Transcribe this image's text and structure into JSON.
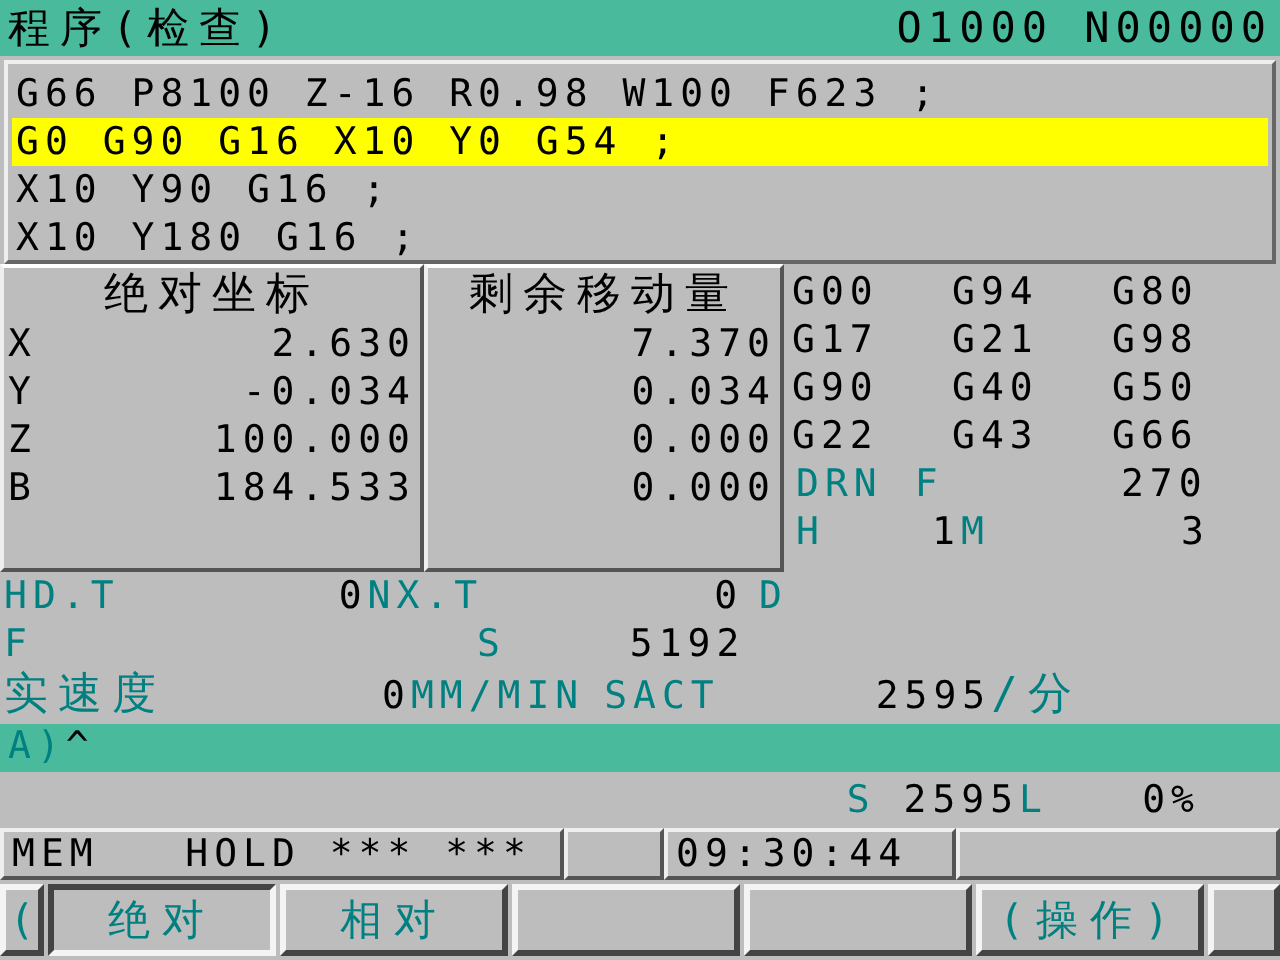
{
  "header": {
    "title": "程序(检查)",
    "program_number": "O1000 N00000"
  },
  "program_lines": [
    {
      "text": "G66 P8100 Z-16 R0.98 W100 F623 ;",
      "selected": false
    },
    {
      "text": "G0 G90 G16 X10 Y0 G54 ;",
      "selected": true
    },
    {
      "text": "X10 Y90 G16 ;",
      "selected": false
    },
    {
      "text": "X10 Y180 G16 ;",
      "selected": false
    }
  ],
  "absolute": {
    "title": "绝对坐标",
    "axes": [
      {
        "axis": "X",
        "value": "2.630"
      },
      {
        "axis": "Y",
        "value": "-0.034"
      },
      {
        "axis": "Z",
        "value": "100.000"
      },
      {
        "axis": "B",
        "value": "184.533"
      }
    ]
  },
  "distance_to_go": {
    "title": "剩余移动量",
    "values": [
      "7.370",
      "0.034",
      "0.000",
      "0.000"
    ]
  },
  "modal_codes": [
    [
      "G00",
      "G94",
      "G80"
    ],
    [
      "G17",
      "G21",
      "G98"
    ],
    [
      "G90",
      "G40",
      "G50"
    ],
    [
      "G22",
      "G43",
      "G66"
    ]
  ],
  "drn": {
    "label": "DRN",
    "feed_label": "F",
    "feed_value": "270"
  },
  "hm": {
    "h_label": "H",
    "h_value": "1",
    "m_label": "M",
    "m_value": "3"
  },
  "tool_row": {
    "hd_label": "HD.T",
    "hd_value": "0",
    "nx_label": "NX.T",
    "nx_value": "0",
    "d_label": "D"
  },
  "fs_row": {
    "f_label": "F",
    "s_label": "S",
    "s_value": "5192"
  },
  "speed_row": {
    "label": "实速度",
    "feed_value": "0",
    "feed_unit": "MM/MIN",
    "sact_label": "SACT",
    "sact_value": "2595",
    "sact_unit": "/分"
  },
  "input_line": {
    "prompt": "A)",
    "cursor": "^"
  },
  "spindle_row": {
    "s_label": "S",
    "s_value": "2595",
    "l_label": "L",
    "l_value": "0%"
  },
  "status_bar": {
    "mode": "MEM",
    "state": "HOLD",
    "alarm_1": "***",
    "alarm_2": "***",
    "time": "09:30:44"
  },
  "softkeys": [
    {
      "kind": "arrow",
      "label": "("
    },
    {
      "kind": "key",
      "label": "绝对",
      "selected": true
    },
    {
      "kind": "key",
      "label": "相对",
      "selected": false
    },
    {
      "kind": "blank"
    },
    {
      "kind": "blank"
    },
    {
      "kind": "key",
      "label": "(操作)",
      "selected": false
    },
    {
      "kind": "end"
    }
  ]
}
